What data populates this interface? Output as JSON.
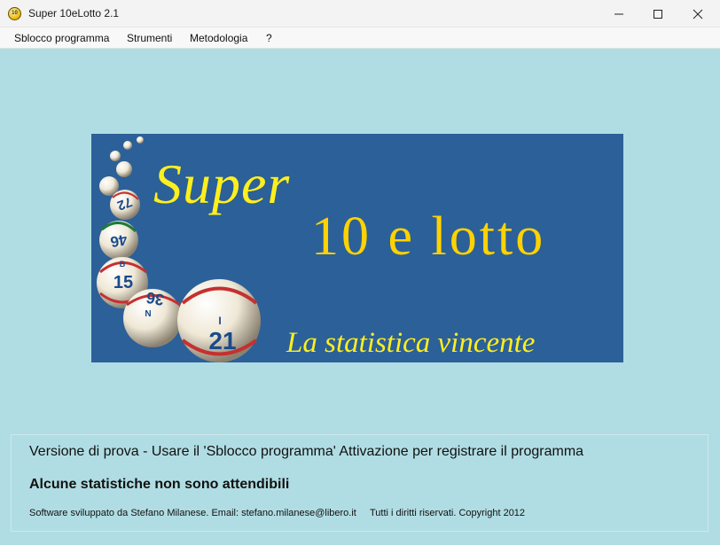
{
  "window": {
    "title": "Super 10eLotto 2.1",
    "icon_label": "10",
    "controls": [
      "minimize",
      "maximize",
      "close"
    ]
  },
  "menu": [
    {
      "label": "Sblocco programma"
    },
    {
      "label": "Strumenti"
    },
    {
      "label": "Metodologia"
    },
    {
      "label": "?"
    }
  ],
  "banner": {
    "title_line1": "Super",
    "title_line2": "10 e lotto",
    "tagline": "La statistica vincente",
    "balls": [
      {
        "number": "21",
        "letter": "I"
      },
      {
        "number": "36",
        "letter": "N"
      },
      {
        "number": "15",
        "letter": "B"
      },
      {
        "number": "46",
        "letter": ""
      },
      {
        "number": "72",
        "letter": ""
      }
    ],
    "colors": {
      "background": "#2c6098",
      "title": "#ffef1e",
      "title2": "#ffd200"
    }
  },
  "info": {
    "trial_notice": "Versione di prova - Usare il 'Sblocco programma' Attivazione per registrare il programma",
    "warning": "Alcune statistiche non sono attendibili",
    "credits": "Software sviluppato da Stefano Milanese. Email: stefano.milanese@libero.it",
    "copyright": "Tutti i diritti riservati. Copyright 2012"
  },
  "colors": {
    "window_background": "#b0dde3"
  }
}
